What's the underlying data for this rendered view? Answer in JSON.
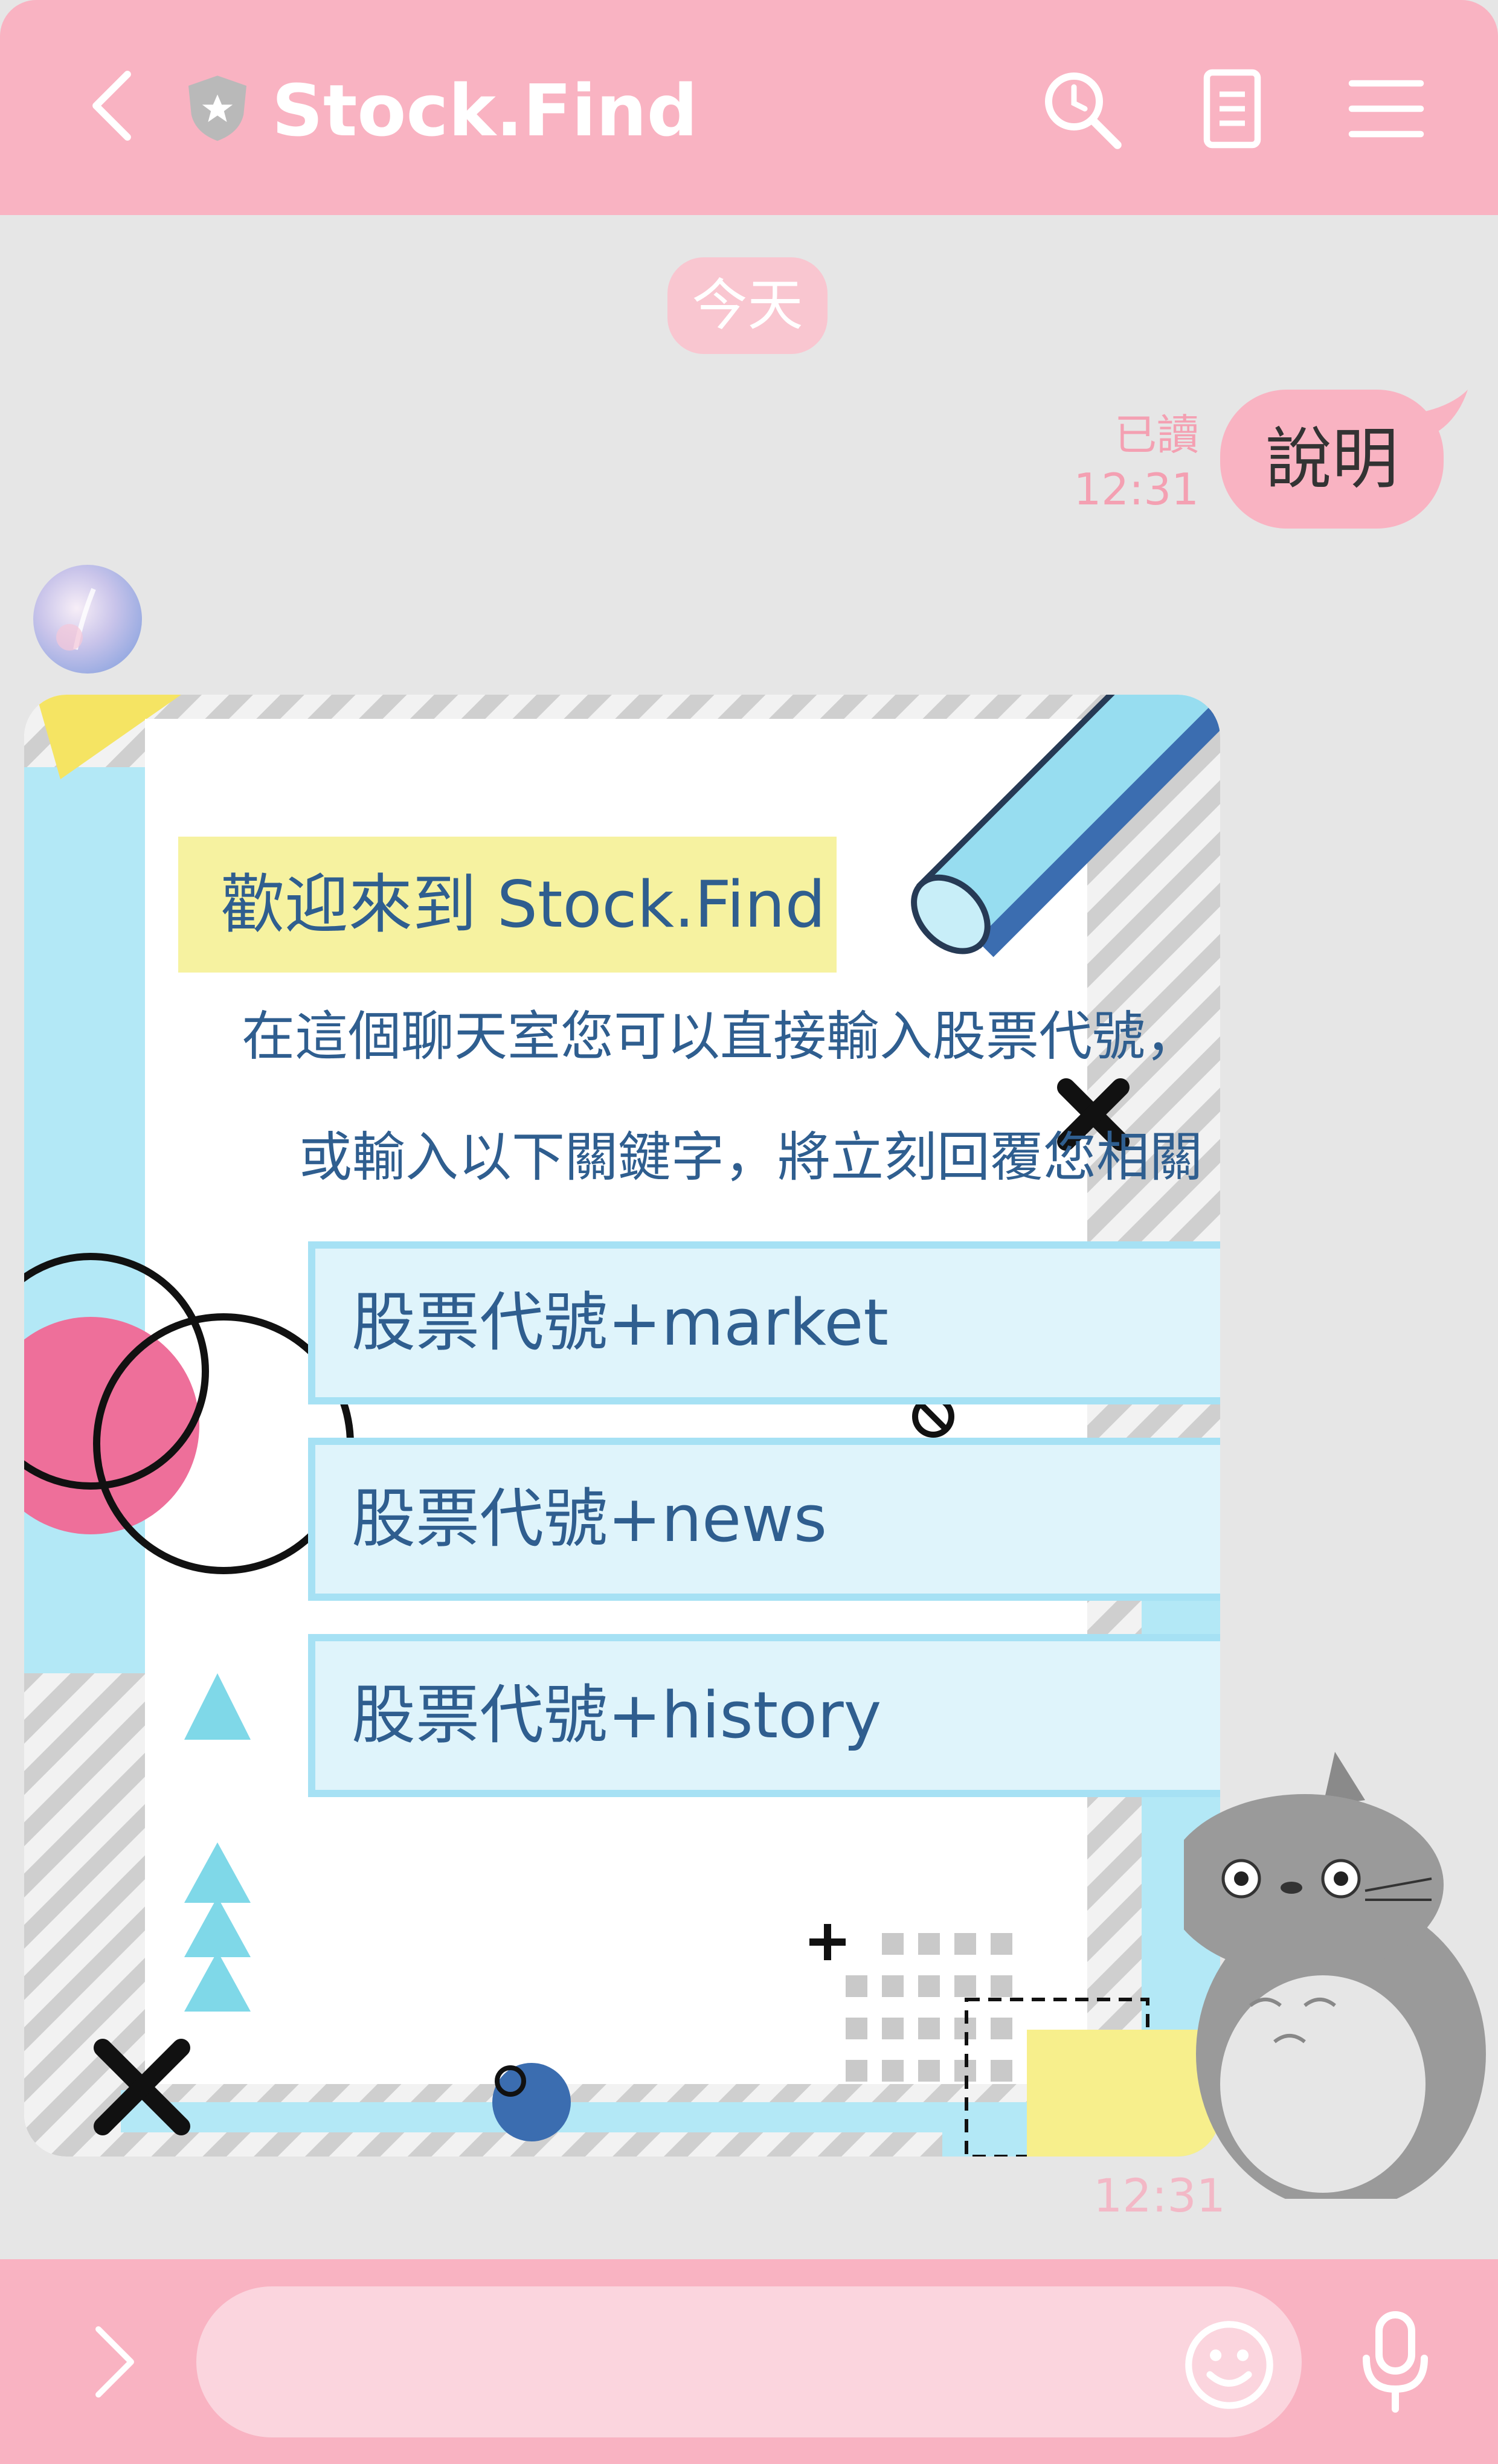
{
  "header": {
    "title": "Stock.Find",
    "icons": [
      "back-icon",
      "shield-star-icon",
      "search-icon",
      "notes-icon",
      "menu-icon"
    ]
  },
  "date_divider": "今天",
  "user_message": {
    "text": "說明",
    "read_status": "已讀",
    "time": "12:31"
  },
  "bot_card": {
    "welcome": "歡迎來到 Stock.Find",
    "intro_line1": "在這個聊天室您可以直接輸入股票代號，",
    "intro_line2": "或輸入以下關鍵字，將立刻回覆您相關",
    "keywords": [
      "股票代號+market",
      "股票代號+news",
      "股票代號+history"
    ],
    "time": "12:31"
  },
  "input_bar": {
    "placeholder": "",
    "icons": [
      "expand-icon",
      "emoji-icon",
      "microphone-icon"
    ]
  },
  "colors": {
    "header_bg": "#f9b3c2",
    "bubble_bg": "#f9b3c2",
    "card_text": "#2f5e8f",
    "keyword_bg": "#dff4fb",
    "keyword_border": "#a6e1f4"
  }
}
